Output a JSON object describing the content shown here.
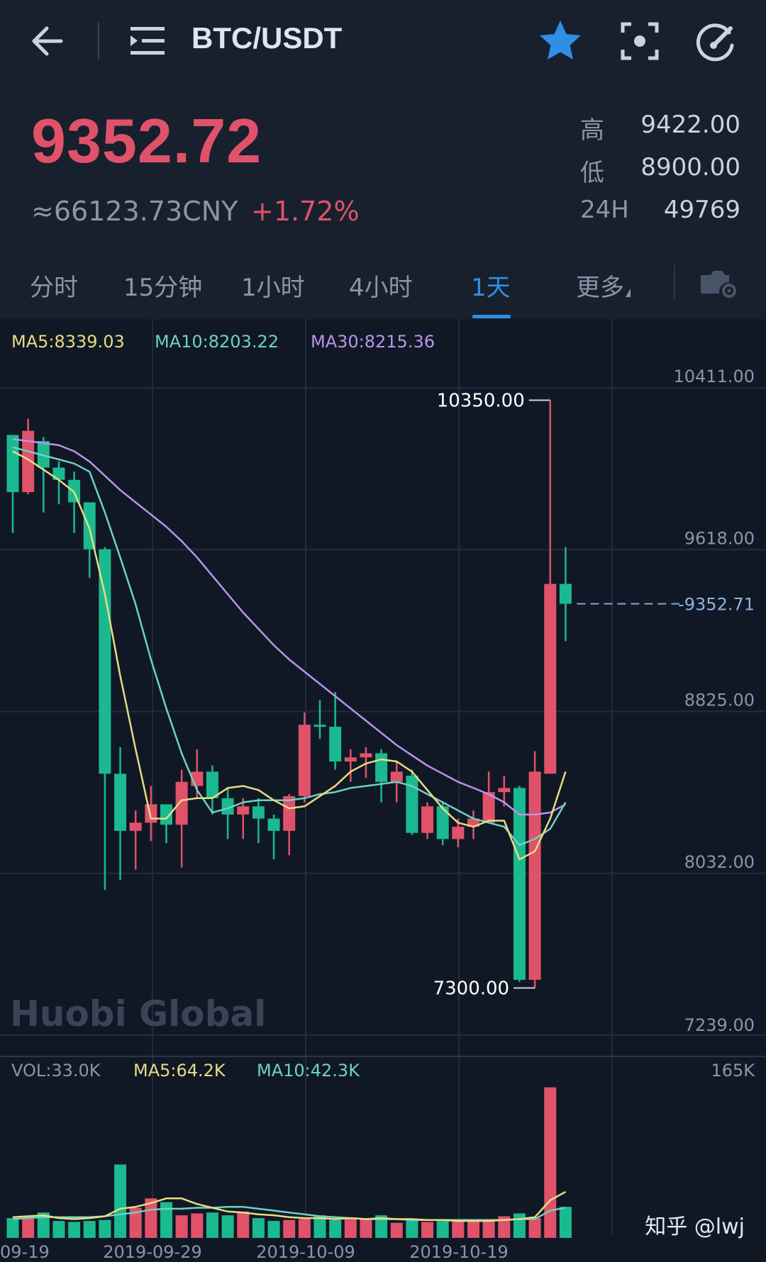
{
  "header": {
    "pair": "BTC/USDT",
    "icons": [
      "back-arrow-icon",
      "menu-icon",
      "star-icon",
      "scan-icon",
      "speedometer-icon"
    ],
    "colors": {
      "star": "#2f8fe6",
      "up": "#e0526a",
      "down": "#1bb990"
    }
  },
  "ticker": {
    "last_price": "9352.72",
    "cny": "≈66123.73CNY",
    "change": "+1.72%",
    "high_label": "高",
    "high": "9422.00",
    "low_label": "低",
    "low": "8900.00",
    "vol_label": "24H",
    "vol": "49769"
  },
  "tabs": [
    {
      "label": "分时",
      "active": false
    },
    {
      "label": "15分钟",
      "active": false
    },
    {
      "label": "1小时",
      "active": false
    },
    {
      "label": "4小时",
      "active": false
    },
    {
      "label": "1天",
      "active": true
    },
    {
      "label": "更多",
      "active": false
    }
  ],
  "chart_data": [
    {
      "type": "candlestick",
      "ma_legend": [
        {
          "text": "MA5:8339.03",
          "color": "#e8dc82"
        },
        {
          "text": "MA10:8203.22",
          "color": "#6fd0c4"
        },
        {
          "text": "MA30:8215.36",
          "color": "#b994ea"
        }
      ],
      "y_ticks": [
        "10411.00",
        "9618.00",
        "8825.00",
        "8032.00",
        "7239.00"
      ],
      "ylim": [
        7239,
        10411
      ],
      "x_ticks": [
        "09-19",
        "2019-09-29",
        "2019-10-09",
        "2019-10-19"
      ],
      "max_label": "10350.00",
      "min_label": "7300.00",
      "current_price_label": "9352.71",
      "watermark": "Huobi Global",
      "candles": [
        [
          10180,
          9900,
          10160,
          9700
        ],
        [
          9900,
          10200,
          10260,
          9890
        ],
        [
          10150,
          10020,
          10170,
          9800
        ],
        [
          10020,
          9960,
          10050,
          9840
        ],
        [
          9960,
          9850,
          10000,
          9700
        ],
        [
          9850,
          9620,
          9850,
          9480
        ],
        [
          9620,
          8520,
          9630,
          7950
        ],
        [
          8520,
          8240,
          8650,
          8000
        ],
        [
          8240,
          8280,
          8340,
          8050
        ],
        [
          8280,
          8370,
          8460,
          8190
        ],
        [
          8370,
          8270,
          8360,
          8180
        ],
        [
          8270,
          8480,
          8540,
          8060
        ],
        [
          8460,
          8530,
          8640,
          8400
        ],
        [
          8530,
          8400,
          8560,
          8320
        ],
        [
          8400,
          8320,
          8450,
          8200
        ],
        [
          8320,
          8360,
          8400,
          8200
        ],
        [
          8360,
          8300,
          8400,
          8180
        ],
        [
          8300,
          8240,
          8320,
          8100
        ],
        [
          8240,
          8410,
          8420,
          8120
        ],
        [
          8410,
          8760,
          8820,
          8380
        ],
        [
          8760,
          8750,
          8880,
          8690
        ],
        [
          8750,
          8580,
          8920,
          8540
        ],
        [
          8580,
          8600,
          8640,
          8480
        ],
        [
          8600,
          8620,
          8650,
          8500
        ],
        [
          8620,
          8480,
          8640,
          8380
        ],
        [
          8480,
          8530,
          8580,
          8380
        ],
        [
          8510,
          8230,
          8540,
          8220
        ],
        [
          8230,
          8360,
          8380,
          8200
        ],
        [
          8360,
          8200,
          8380,
          8170
        ],
        [
          8200,
          8260,
          8300,
          8160
        ],
        [
          8260,
          8300,
          8340,
          8200
        ],
        [
          8280,
          8430,
          8530,
          8300
        ],
        [
          8430,
          8450,
          8510,
          8360
        ],
        [
          8450,
          7510,
          8460,
          7500
        ],
        [
          7510,
          8530,
          8630,
          7470
        ],
        [
          8520,
          9450,
          10350,
          8520
        ],
        [
          9450,
          9352.72,
          9630,
          9170
        ]
      ],
      "ma5": [
        10100,
        10060,
        10010,
        9960,
        9900,
        9720,
        9400,
        9000,
        8640,
        8300,
        8300,
        8390,
        8400,
        8400,
        8450,
        8460,
        8440,
        8390,
        8350,
        8360,
        8410,
        8460,
        8530,
        8570,
        8590,
        8580,
        8530,
        8440,
        8350,
        8280,
        8260,
        8290,
        8290,
        8100,
        8140,
        8300,
        8530
      ],
      "ma10": [
        10120,
        10100,
        10080,
        10060,
        10040,
        10000,
        9800,
        9580,
        9350,
        9080,
        8840,
        8620,
        8440,
        8330,
        8350,
        8380,
        8390,
        8390,
        8390,
        8400,
        8420,
        8430,
        8450,
        8460,
        8470,
        8480,
        8460,
        8420,
        8380,
        8340,
        8300,
        8280,
        8260,
        8170,
        8200,
        8250,
        8380
      ],
      "ma30": [
        10160,
        10150,
        10140,
        10130,
        10100,
        10050,
        9980,
        9910,
        9850,
        9790,
        9730,
        9660,
        9580,
        9490,
        9400,
        9310,
        9230,
        9150,
        9080,
        9020,
        8960,
        8900,
        8840,
        8780,
        8720,
        8660,
        8610,
        8560,
        8520,
        8480,
        8450,
        8420,
        8380,
        8320,
        8320,
        8330,
        8370
      ]
    },
    {
      "type": "bar",
      "legend": [
        {
          "text": "VOL:33.0K",
          "color": "#8a95a8"
        },
        {
          "text": "MA5:64.2K",
          "color": "#e8dc82"
        },
        {
          "text": "MA10:42.3K",
          "color": "#6fd0c4"
        }
      ],
      "y_max_label": "165K",
      "ylim": [
        0,
        165
      ],
      "volumes": [
        21,
        22,
        27,
        18,
        17,
        18,
        19,
        78,
        32,
        42,
        38,
        24,
        26,
        27,
        24,
        28,
        21,
        18,
        19,
        20,
        24,
        19,
        21,
        20,
        24,
        16,
        20,
        17,
        18,
        19,
        18,
        20,
        23,
        26,
        21,
        160,
        33
      ],
      "ma5": [
        22,
        23,
        24,
        21,
        20,
        21,
        23,
        31,
        33,
        37,
        42,
        42,
        36,
        32,
        28,
        27,
        25,
        24,
        22,
        21,
        21,
        20,
        21,
        20,
        21,
        20,
        20,
        19,
        19,
        18,
        18,
        18,
        19,
        20,
        22,
        40,
        49
      ],
      "ma10": [
        20,
        21,
        22,
        22,
        22,
        22,
        23,
        25,
        27,
        30,
        31,
        31,
        32,
        32,
        33,
        33,
        31,
        29,
        27,
        25,
        23,
        22,
        21,
        20,
        20,
        20,
        19,
        19,
        19,
        19,
        19,
        19,
        19,
        20,
        20,
        29,
        32
      ]
    }
  ],
  "footer_watermark": "知乎 @lwj"
}
